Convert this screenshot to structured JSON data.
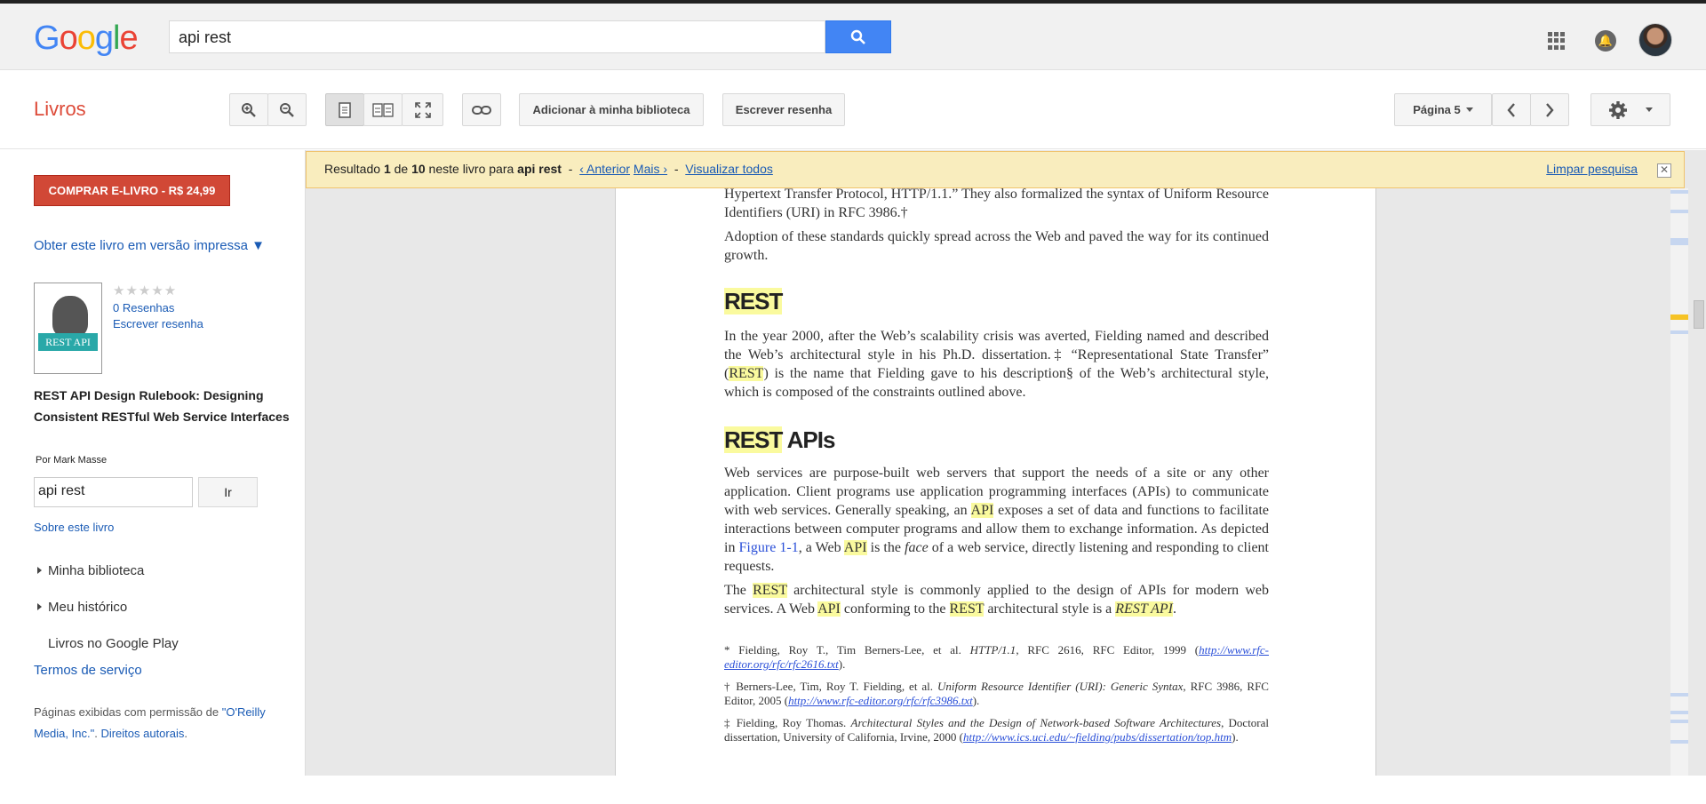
{
  "header": {
    "logo": [
      "G",
      "o",
      "o",
      "g",
      "l",
      "e"
    ],
    "search_value": "api rest"
  },
  "toolbar": {
    "section_title": "Livros",
    "add_library": "Adicionar à minha biblioteca",
    "write_review": "Escrever resenha",
    "page_label": "Página 5"
  },
  "sidebar": {
    "buy_button": "COMPRAR E-LIVRO - R$ 24,99",
    "print_link": "Obter este livro em versão impressa ▼",
    "cover_title": "REST API",
    "stars": "★★★★★",
    "reviews": "0 Resenhas",
    "write_review": "Escrever resenha",
    "book_title": "REST API Design Rulebook: Designing Consistent RESTful Web Service Interfaces",
    "author": "Por Mark Masse",
    "inbook_search_value": "api rest",
    "go_button": "Ir",
    "about": "Sobre este livro",
    "my_library": "Minha biblioteca",
    "my_history": "Meu histórico",
    "play_books": "Livros no Google Play",
    "terms": "Termos de serviço",
    "footer_prefix": "Páginas exibidas com permissão de ",
    "footer_publisher": "\"O'Reilly Media, Inc.\"",
    "footer_sep": ". ",
    "footer_rights": "Direitos autorais",
    "footer_end": "."
  },
  "result_bar": {
    "prefix": "Resultado ",
    "num": "1",
    "of": " de ",
    "total": "10",
    "in_book": " neste livro para ",
    "query": "api rest",
    "dash1": "  -  ",
    "prev": "‹ Anterior",
    "next": "Mais ›",
    "dash2": "  -  ",
    "view_all": "Visualizar todos",
    "clear": "Limpar pesquisa"
  },
  "page": {
    "p0": "Hypertext Transfer Protocol, HTTP/1.1.” They also formalized the syntax of Uniform Resource Identifiers (URI) in RFC 3986.†",
    "p1": "Adoption of these standards quickly spread across the Web and paved the way for its continued growth.",
    "h_rest": "REST",
    "p2a": "In the year 2000, after the Web’s scalability crisis was averted, Fielding named and described the Web’s architectural style in his Ph.D. dissertation.‡ “Representational State Transfer” (",
    "p2_hl": "REST",
    "p2b": ") is the name that Fielding gave to his description§ of the Web’s architectural style, which is composed of the constraints outlined above.",
    "h_apis_hl": "REST",
    "h_apis": " APIs",
    "p3a": "Web services are purpose-built web servers that support the needs of a site or any other application. Client programs use application programming interfaces (APIs) to communicate with web services. Generally speaking, an ",
    "p3_hl1": "API",
    "p3b": " exposes a set of data and functions to facilitate interactions between computer programs and allow them to exchange information. As depicted in ",
    "p3_fig": "Figure 1-1",
    "p3c": ", a Web ",
    "p3_hl2": "API",
    "p3d": " is the ",
    "p3_face": "face",
    "p3e": " of a web service, directly listening and responding to client requests.",
    "p4a": "The ",
    "p4_hl1": "REST",
    "p4b": " architectural style is commonly applied to the design of APIs for modern web services. A Web ",
    "p4_hl2": "API",
    "p4c": " conforming to the ",
    "p4_hl3": "REST",
    "p4d": " architectural style is a ",
    "p4_hl4": "REST API",
    "p4e": ".",
    "fn1a": "* Fielding, Roy T., Tim Berners-Lee, et al. ",
    "fn1i": "HTTP/1.1",
    "fn1b": ", RFC 2616, RFC Editor, 1999 (",
    "fn1u": "http://www.rfc-editor.org/rfc/rfc2616.txt",
    "fn1c": ").",
    "fn2a": "† Berners-Lee, Tim, Roy T. Fielding, et al. ",
    "fn2i": "Uniform Resource Identifier (URI): Generic Syntax",
    "fn2b": ", RFC 3986, RFC Editor, 2005 (",
    "fn2u": "http://www.rfc-editor.org/rfc/rfc3986.txt",
    "fn2c": ").",
    "fn3a": "‡ Fielding, Roy Thomas. ",
    "fn3i": "Architectural Styles and the Design of Network-based Software Architectures",
    "fn3b": ", Doctoral dissertation, University of California, Irvine, 2000 (",
    "fn3u": "http://www.ics.uci.edu/~fielding/pubs/dissertation/top.htm",
    "fn3c": ")."
  }
}
